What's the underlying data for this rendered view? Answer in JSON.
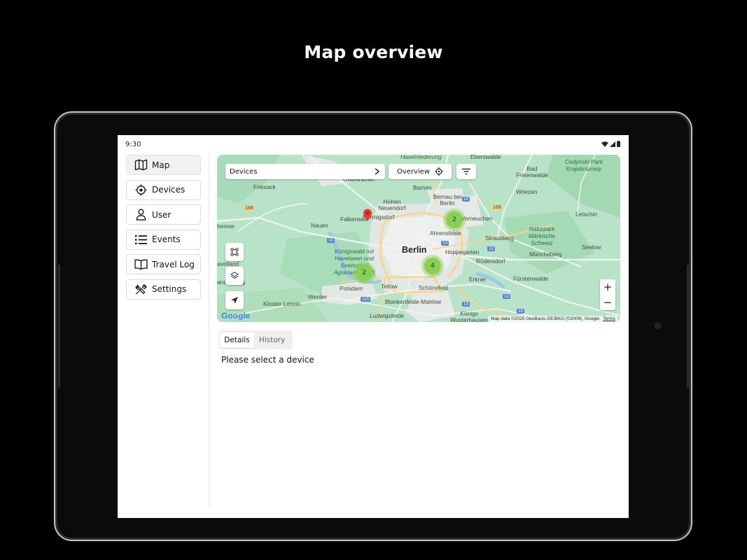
{
  "headline": "Map overview",
  "status_bar": {
    "time": "9:30"
  },
  "sidebar": {
    "items": [
      {
        "label": "Map",
        "icon": "map-icon",
        "active": true
      },
      {
        "label": "Devices",
        "icon": "crosshair-icon",
        "active": false
      },
      {
        "label": "User",
        "icon": "user-icon",
        "active": false
      },
      {
        "label": "Events",
        "icon": "list-icon",
        "active": false
      },
      {
        "label": "Travel Log",
        "icon": "book-icon",
        "active": false
      },
      {
        "label": "Settings",
        "icon": "tools-icon",
        "active": false
      }
    ]
  },
  "map": {
    "devices_selector": "Devices",
    "overview_button": "Overview",
    "zoom_in": "+",
    "zoom_out": "−",
    "google_logo": "Google",
    "attribution": "Map data ©2025 GeoBasis-DE/BKG (©2009), Google",
    "terms": "Terms",
    "clusters": [
      {
        "count": "2"
      },
      {
        "count": "4"
      },
      {
        "count": "2"
      }
    ],
    "labels": {
      "berlin": "Berlin",
      "havelniederung": "Havelniederung",
      "eberswalde": "Eberswalde",
      "bad_freienwalde": "Bad Freienwalde",
      "cedynski": "Cedyński Park Krajobrazowy",
      "friesack": "Friesack",
      "oberkramer": "Oberkrämer",
      "barnim": "Barnim",
      "wriezen": "Wriezen",
      "hohen_neuendorf": "Hohen Neuendorf",
      "bernau": "Bernau bei Berlin",
      "hennigsdorf": "Hennigsdorf",
      "werneuchen": "Werneuchen",
      "letschin": "Letschin",
      "nauen": "Nauen",
      "falkensee": "Falkensee",
      "ahrensfelde": "Ahrensfelde",
      "rathenow": "henow",
      "naturpark": "Naturpark Märkische Schweiz",
      "strausberg": "Strausberg",
      "seelow": "Seelow",
      "konigswald": "Königswald mit Havelseen und Seeburger Agrarlandschaft",
      "hoppegarten": "Hoppegarten",
      "havelland": "avelland",
      "rudersdorf": "Rüdersdorf",
      "muncheberg": "Müncheberg",
      "brandenburg": "andenburg",
      "potsdam": "Potsdam",
      "teltow": "Teltow",
      "schonefeld": "Schönefeld",
      "erkner": "Erkner",
      "furstenwalde": "Fürstenwalde",
      "werder": "Werder",
      "kloster_lehnin": "Kloster Lehnin",
      "blankenfelde": "Blankenfelde-Mahlow",
      "ludwigsfelde": "Ludwigsfelde",
      "konigs_wusterhausen": "Königs Wusterhausen",
      "r188": "188",
      "r168": "168",
      "r10a": "10",
      "r10b": "10",
      "r10c": "10",
      "r10d": "10",
      "r10e": "10",
      "r115": "115",
      "r13": "13",
      "r12": "12"
    }
  },
  "details_tabs": {
    "details": "Details",
    "history": "History"
  },
  "message": "Please select a device"
}
